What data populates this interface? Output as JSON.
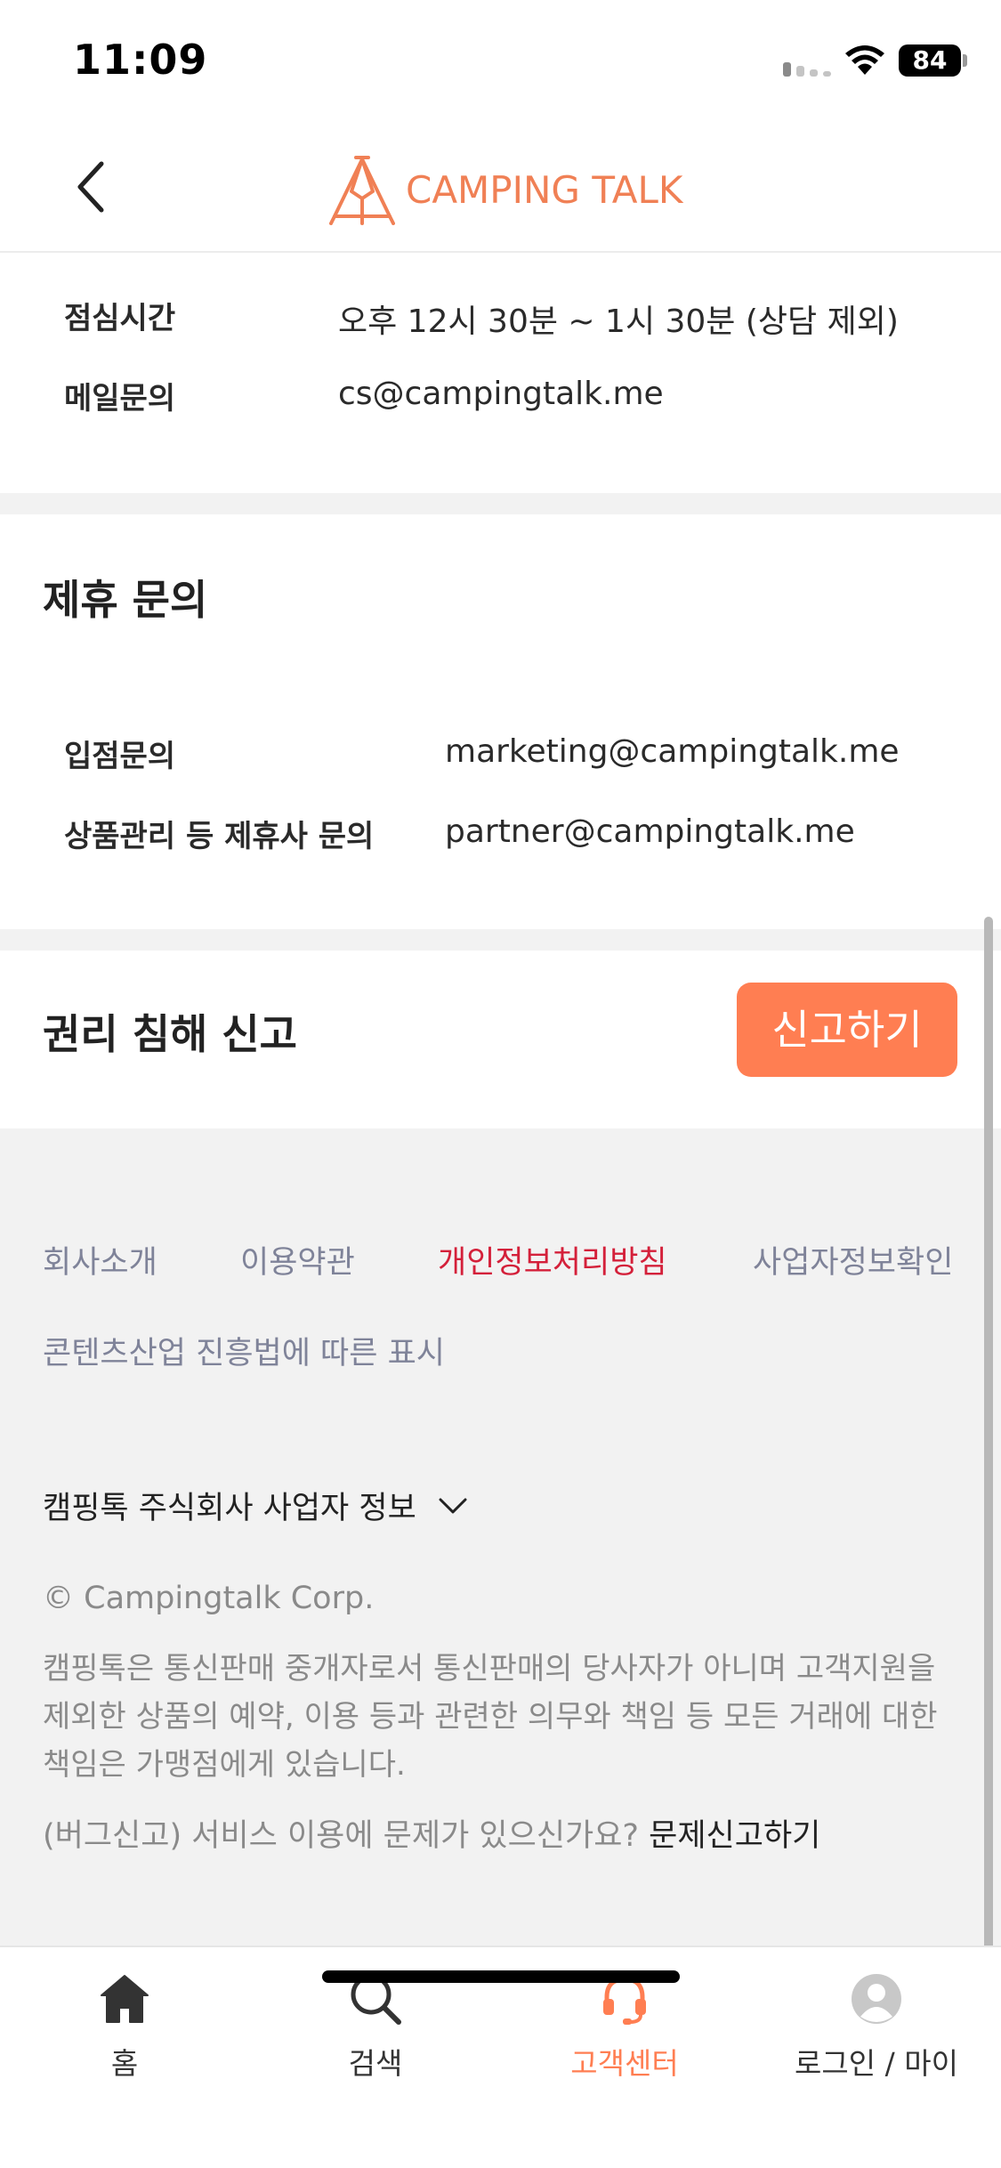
{
  "status_bar": {
    "time": "11:09",
    "battery": "84"
  },
  "header": {
    "logo_text": "CAMPING TALK"
  },
  "cs_section": {
    "rows": [
      {
        "label": "점심시간",
        "value": "오후 12시 30분 ~ 1시 30분 (상담 제외)"
      },
      {
        "label": "메일문의",
        "value": "cs@campingtalk.me"
      }
    ]
  },
  "partner_section": {
    "title": "제휴 문의",
    "rows": [
      {
        "label": "입점문의",
        "value": "marketing@campingtalk.me"
      },
      {
        "label": "상품관리 등 제휴사 문의",
        "value": "partner@campingtalk.me"
      }
    ]
  },
  "rights_section": {
    "title": "권리 침해 신고",
    "button_label": "신고하기"
  },
  "footer": {
    "links": [
      "회사소개",
      "이용약관",
      "개인정보처리방침",
      "사업자정보확인",
      "콘텐츠산업 진흥법에 따른 표시"
    ],
    "highlight_color": "#d4203a",
    "business_info_toggle": "캠핑톡 주식회사 사업자 정보",
    "copyright": "© Campingtalk Corp.",
    "disclaimer": "캠핑톡은 통신판매 중개자로서 통신판매의 당사자가 아니며 고객지원을 제외한 상품의 예약, 이용 등과 관련한 의무와 책임 등 모든 거래에 대한 책임은 가맹점에게 있습니다.",
    "bug_text": "(버그신고) 서비스 이용에 문제가 있으신가요?",
    "bug_link": "문제신고하기"
  },
  "bottom_nav": {
    "items": [
      {
        "label": "홈",
        "icon": "home-icon"
      },
      {
        "label": "검색",
        "icon": "search-icon"
      },
      {
        "label": "고객센터",
        "icon": "headset-icon"
      },
      {
        "label": "로그인 / 마이",
        "icon": "profile-icon"
      }
    ],
    "active_index": 2,
    "active_color": "#ff7e52"
  },
  "brand_color": "#f08055"
}
